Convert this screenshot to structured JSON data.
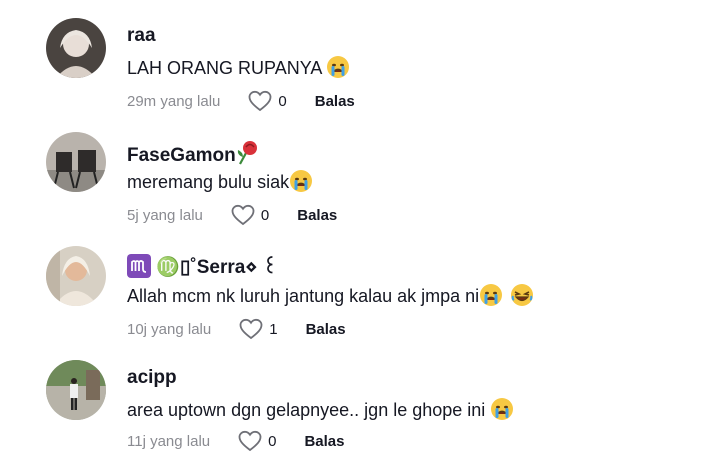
{
  "comments": [
    {
      "username": "raa",
      "text": "LAH ORANG RUPANYA ",
      "time": "29m yang lalu",
      "likes": "0",
      "reply": "Balas",
      "emojis": [
        "crying-face"
      ]
    },
    {
      "username": "FaseGamon",
      "text": "meremang bulu siak",
      "time": "5j yang lalu",
      "likes": "0",
      "reply": "Balas",
      "name_emoji": "rose-icon",
      "emojis": [
        "crying-face"
      ]
    },
    {
      "username": "♍▯˚Serra⋄ ꒰",
      "text": "Allah mcm nk luruh jantung kalau ak jmpa ni",
      "time": "10j yang lalu",
      "likes": "1",
      "reply": "Balas",
      "emojis": [
        "crying-face",
        "laughing-face"
      ]
    },
    {
      "username": "acipp",
      "text": "area uptown dgn gelapnyee.. jgn le ghope ini ",
      "time": "11j yang lalu",
      "likes": "0",
      "reply": "Balas",
      "emojis": [
        "crying-face"
      ]
    }
  ],
  "colors": {
    "text": "#161823",
    "muted": "#8a8b91",
    "emoji_face": "#f7c843",
    "tear": "#3fa0e6"
  }
}
